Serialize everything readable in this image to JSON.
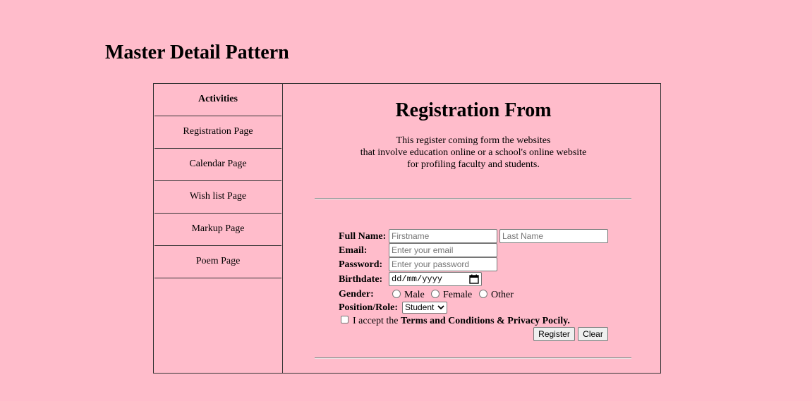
{
  "page": {
    "title": "Master Detail Pattern"
  },
  "sidebar": {
    "header": "Activities",
    "items": [
      {
        "label": "Registration Page"
      },
      {
        "label": "Calendar Page"
      },
      {
        "label": "Wish list Page"
      },
      {
        "label": "Markup Page"
      },
      {
        "label": "Poem Page"
      }
    ]
  },
  "form": {
    "title": "Registration From",
    "description": [
      "This register coming form the websites",
      "that involve education online or a school's online website",
      "for profiling faculty and students."
    ],
    "full_name": {
      "label": "Full Name:",
      "first_placeholder": "Firstname",
      "first_value": "",
      "last_placeholder": "Last Name",
      "last_value": ""
    },
    "email": {
      "label": "Email:",
      "placeholder": "Enter your email",
      "value": ""
    },
    "password": {
      "label": "Password:",
      "placeholder": "Enter your password",
      "value": ""
    },
    "birthdate": {
      "label": "Birthdate:",
      "value": "dd/mm/yyyy",
      "icon": "calendar-icon"
    },
    "gender": {
      "label": "Gender:",
      "options": [
        "Male",
        "Female",
        "Other"
      ],
      "selected": null
    },
    "position": {
      "label": "Position/Role:",
      "selected": "Student",
      "icon": "chevron-down-icon"
    },
    "terms": {
      "checked": false,
      "prefix": "I accept the ",
      "bold": "Terms and Conditions & Privacy Pocily."
    },
    "buttons": {
      "register": "Register",
      "clear": "Clear"
    }
  },
  "colors": {
    "background": "#ffbccb",
    "border": "#333333",
    "button": "#efefef"
  }
}
